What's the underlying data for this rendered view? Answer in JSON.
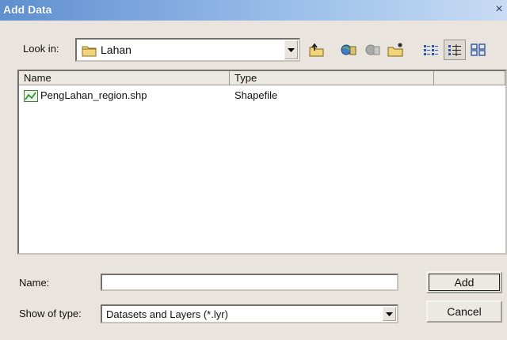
{
  "window": {
    "title": "Add Data",
    "close_glyph": "×"
  },
  "look_in": {
    "label": "Look in:",
    "value": "Lahan",
    "icon": "folder-icon"
  },
  "toolbar": {
    "buttons": [
      {
        "name": "up-one-level-icon"
      },
      {
        "name": "connect-folder-icon"
      },
      {
        "name": "disconnect-folder-icon"
      },
      {
        "name": "new-folder-icon"
      },
      {
        "name": "list-view-icon"
      },
      {
        "name": "details-view-icon",
        "pressed": true
      },
      {
        "name": "thumbnails-view-icon"
      }
    ]
  },
  "file_list": {
    "columns": [
      "Name",
      "Type"
    ],
    "rows": [
      {
        "name": "PengLahan_region.shp",
        "type": "Shapefile",
        "icon": "shapefile-icon"
      }
    ]
  },
  "name_field": {
    "label": "Name:",
    "value": ""
  },
  "type_field": {
    "label": "Show of type:",
    "value": "Datasets and Layers (*.lyr)"
  },
  "buttons": {
    "add": "Add",
    "cancel": "Cancel"
  },
  "colors": {
    "titlebar_start": "#5f8fd0",
    "titlebar_end": "#c8dcf3",
    "dialog_bg": "#e9e5de"
  }
}
